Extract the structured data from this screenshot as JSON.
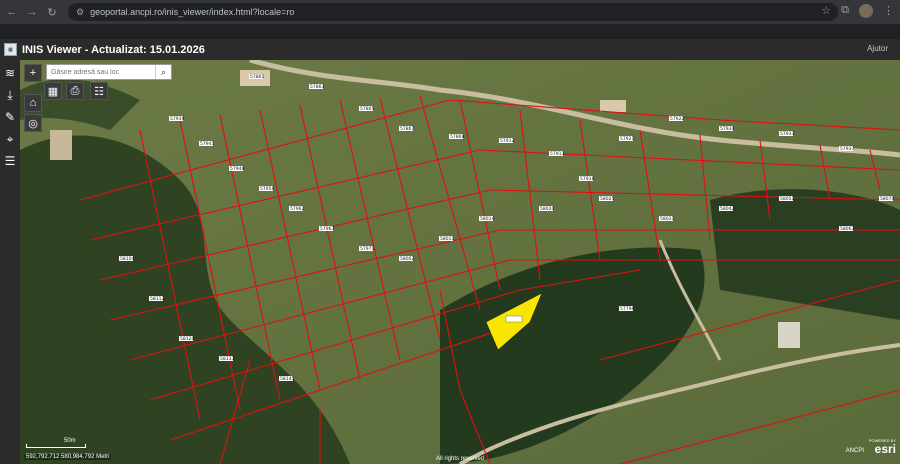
{
  "browser": {
    "url": "geoportal.ancpi.ro/inis_viewer/index.html?locale=ro"
  },
  "header": {
    "title": "INIS Viewer - Actualizat: 15.01.2026",
    "help": "Ajutor"
  },
  "search": {
    "placeholder": "Găsire adresă sau loc"
  },
  "map": {
    "scale_label": "50m",
    "coordinates": "592,792.712 580,984.792 Metri",
    "attribution": "All rights reserved",
    "ancpi": "ANCPI",
    "esri": "esri",
    "powered": "POWERED BY",
    "parcel_highlight_color": "#f7e600",
    "parcel_line_color": "#e01010",
    "labels": [
      {
        "t": "57861"
      },
      {
        "t": "57863"
      },
      {
        "t": "57865"
      },
      {
        "t": "57867"
      },
      {
        "t": "57869"
      },
      {
        "t": "57912"
      },
      {
        "t": "57913"
      },
      {
        "t": "57918"
      },
      {
        "t": "57921"
      },
      {
        "t": "57922"
      },
      {
        "t": "57930"
      },
      {
        "t": "57933"
      },
      {
        "t": "57937"
      },
      {
        "t": "57939"
      },
      {
        "t": "57941"
      },
      {
        "t": "57949"
      },
      {
        "t": "57956"
      },
      {
        "t": "57962"
      },
      {
        "t": "57967"
      },
      {
        "t": "57971"
      },
      {
        "t": "58002"
      },
      {
        "t": "58011"
      },
      {
        "t": "58014"
      },
      {
        "t": "58020"
      },
      {
        "t": "58025"
      },
      {
        "t": "58031"
      },
      {
        "t": "58042"
      },
      {
        "t": "58051"
      },
      {
        "t": "58063"
      },
      {
        "t": "58070"
      },
      {
        "t": "58104"
      },
      {
        "t": "58112"
      },
      {
        "t": "58120"
      },
      {
        "t": "58133"
      },
      {
        "t": "58145"
      },
      {
        "t": "57796"
      }
    ]
  }
}
